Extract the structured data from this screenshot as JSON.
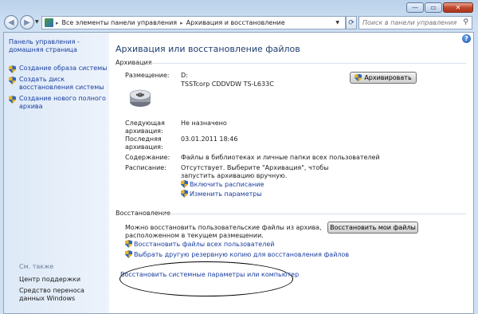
{
  "window": {
    "minimize_glyph": "—",
    "maximize_glyph": "▭",
    "close_glyph": "✕"
  },
  "address": {
    "crumb_1": "Все элементы панели управления",
    "crumb_2": "Архивация и восстановление",
    "search_placeholder": "Поиск в панели управления"
  },
  "sidebar": {
    "home": "Панель управления - домашняя страница",
    "tasks": [
      {
        "label": "Создание образа системы"
      },
      {
        "label": "Создать диск восстановления системы"
      },
      {
        "label": "Создание нового полного архива"
      }
    ],
    "see_also_title": "См. также",
    "see_also": [
      {
        "label": "Центр поддержки"
      },
      {
        "label": "Средство переноса данных Windows"
      }
    ]
  },
  "main": {
    "title": "Архивация или восстановление файлов",
    "backup": {
      "section_title": "Архивация",
      "location_label": "Размещение:",
      "location_drive": "D:",
      "location_device": "TSSTcorp CDDVDW TS-L633C",
      "archive_button": "Архивировать",
      "next_label": "Следующая архивация:",
      "next_value": "Не назначено",
      "last_label": "Последняя архивация:",
      "last_value": "03.01.2011 18:46",
      "contents_label": "Содержание:",
      "contents_value": "Файлы в библиотеках и личные папки всех пользователей",
      "schedule_label": "Расписание:",
      "schedule_value": "Отсутствует. Выберите \"Архивация\", чтобы запустить архивацию вручную.",
      "enable_schedule": "Включить расписание",
      "change_settings": "Изменить параметры"
    },
    "restore": {
      "section_title": "Восстановление",
      "description": "Можно восстановить пользовательские файлы из архива, расположенном в текущем размещении.",
      "restore_button": "Восстановить мои файлы",
      "restore_all": "Восстановить файлы всех пользователей",
      "choose_other": "Выбрать другую резервную копию для восстановления файлов",
      "recover_system": "Восстановить системные параметры или компьютер"
    }
  }
}
